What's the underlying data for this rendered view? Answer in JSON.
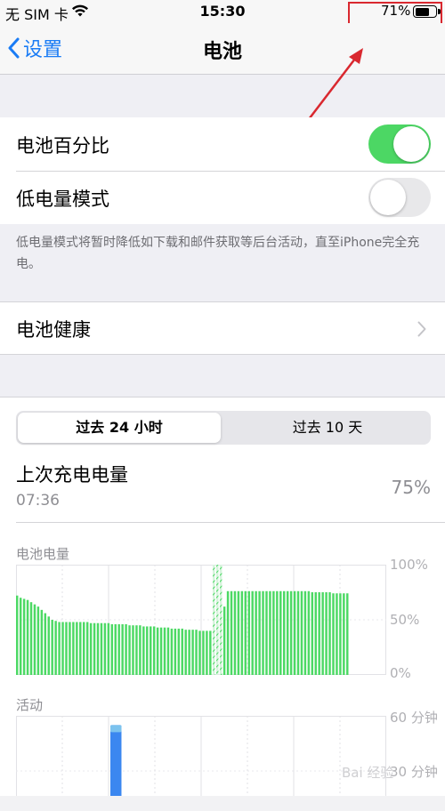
{
  "status_bar": {
    "carrier": "无 SIM 卡",
    "time": "15:30",
    "battery_percent": "71%",
    "battery_level": 0.71
  },
  "nav": {
    "back_label": "设置",
    "title": "电池"
  },
  "settings": {
    "battery_percentage": {
      "label": "电池百分比",
      "on": true
    },
    "low_power_mode": {
      "label": "低电量模式",
      "on": false
    },
    "low_power_note": "低电量模式将暂时降低如下载和邮件获取等后台活动，直至iPhone完全充电。",
    "battery_health": {
      "label": "电池健康"
    }
  },
  "usage": {
    "tabs": [
      "过去 24 小时",
      "过去 10 天"
    ],
    "active_tab": 0,
    "last_charge": {
      "title": "上次充电电量",
      "time": "07:36",
      "level": "75%"
    },
    "battery_level_chart": {
      "label": "电池电量",
      "y_ticks": [
        "100%",
        "50%",
        "0%"
      ]
    },
    "activity_chart": {
      "label": "活动",
      "y_ticks": [
        "60 分钟",
        "30 分钟"
      ]
    }
  },
  "colors": {
    "accent": "#1a7cf5",
    "toggle_on": "#4cd764",
    "battery_bar": "#4cd964",
    "activity_bar": "#3b87f0",
    "annotation": "#d9282f"
  },
  "watermark": "Bai 经验",
  "chart_data": [
    {
      "type": "bar",
      "title": "电池电量",
      "ylim": [
        0,
        100
      ],
      "values": [
        72,
        70,
        69,
        68,
        66,
        64,
        62,
        59,
        56,
        53,
        50,
        49,
        48,
        48,
        48,
        48,
        48,
        48,
        48,
        48,
        48,
        47,
        47,
        47,
        47,
        47,
        47,
        46,
        46,
        46,
        46,
        46,
        45,
        45,
        45,
        45,
        44,
        44,
        44,
        44,
        43,
        43,
        43,
        43,
        42,
        42,
        42,
        42,
        41,
        41,
        41,
        41,
        40,
        40,
        40,
        40,
        100,
        100,
        100,
        62,
        76,
        76,
        76,
        76,
        76,
        76,
        76,
        76,
        76,
        76,
        76,
        76,
        76,
        76,
        76,
        76,
        76,
        76,
        76,
        76,
        76,
        76,
        76,
        76,
        75,
        75,
        75,
        75,
        75,
        75,
        74,
        74,
        74,
        74,
        74
      ]
    },
    {
      "type": "bar",
      "title": "活动",
      "ylim": [
        0,
        60
      ],
      "values": [
        0,
        0,
        0,
        0,
        0,
        10,
        55,
        0,
        0,
        0,
        0,
        0,
        0,
        0,
        0,
        0,
        0,
        0,
        0,
        0,
        0,
        0,
        0,
        0
      ]
    }
  ]
}
